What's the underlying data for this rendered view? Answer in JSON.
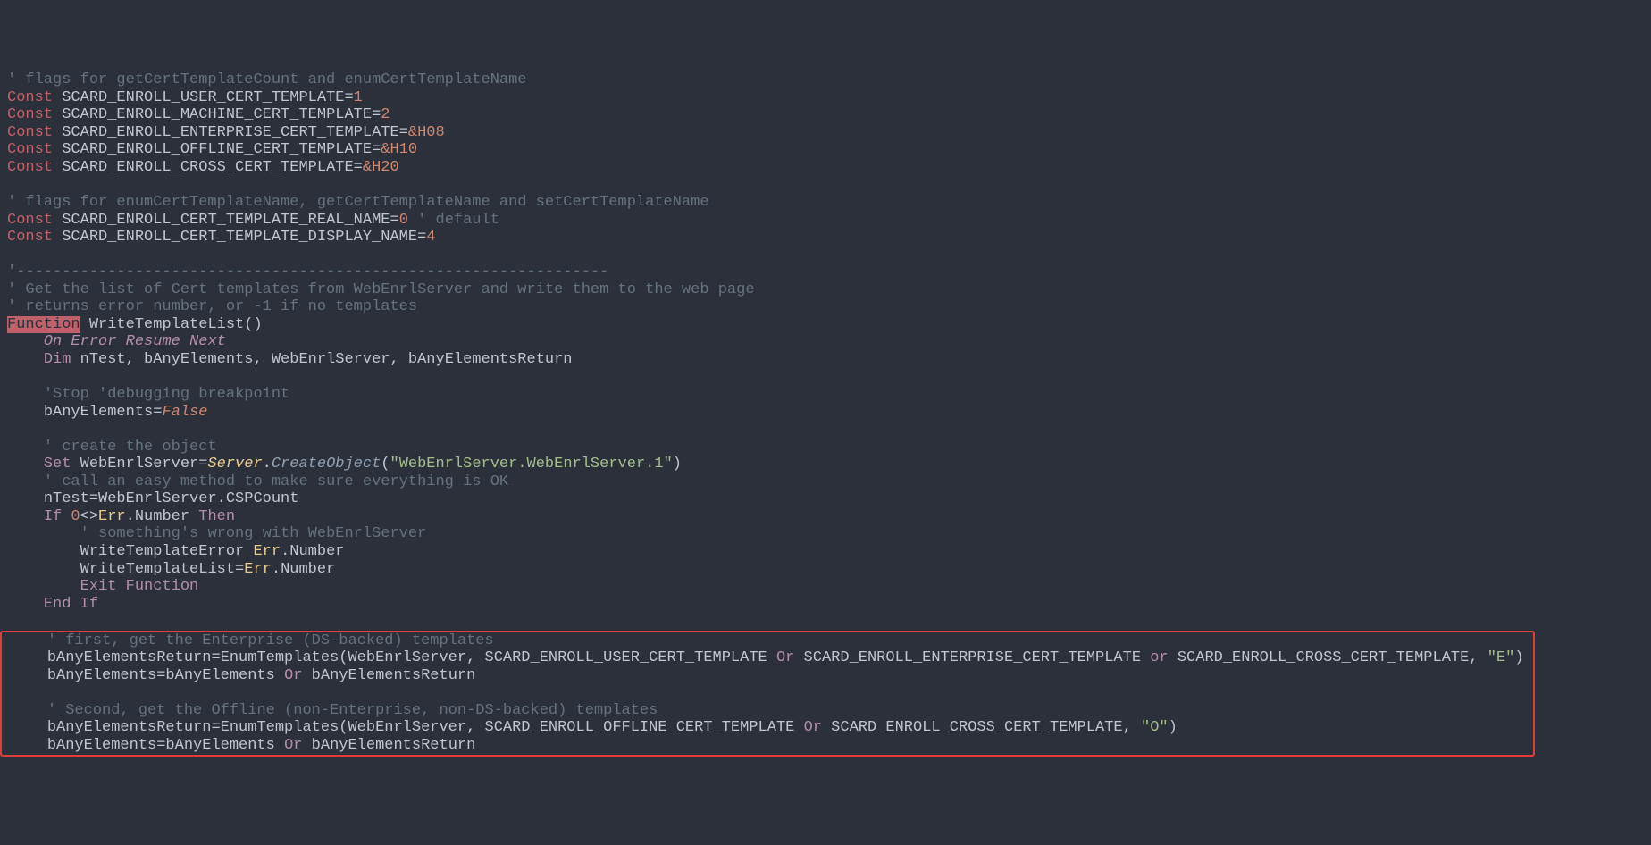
{
  "lines": {
    "l1": {
      "comment": "' flags for getCertTemplateCount and enumCertTemplateName"
    },
    "l2": {
      "kw": "Const",
      "rest": " SCARD_ENROLL_USER_CERT_TEMPLATE=",
      "num": "1"
    },
    "l3": {
      "kw": "Const",
      "rest": " SCARD_ENROLL_MACHINE_CERT_TEMPLATE=",
      "num": "2"
    },
    "l4": {
      "kw": "Const",
      "rest": " SCARD_ENROLL_ENTERPRISE_CERT_TEMPLATE=",
      "num": "&H08"
    },
    "l5": {
      "kw": "Const",
      "rest": " SCARD_ENROLL_OFFLINE_CERT_TEMPLATE=",
      "num": "&H10"
    },
    "l6": {
      "kw": "Const",
      "rest": " SCARD_ENROLL_CROSS_CERT_TEMPLATE=",
      "num": "&H20"
    },
    "l8": {
      "comment": "' flags for enumCertTemplateName, getCertTemplateName and setCertTemplateName"
    },
    "l9": {
      "kw": "Const",
      "rest": " SCARD_ENROLL_CERT_TEMPLATE_REAL_NAME=",
      "num": "0",
      "trail": " ' default"
    },
    "l10": {
      "kw": "Const",
      "rest": " SCARD_ENROLL_CERT_TEMPLATE_DISPLAY_NAME=",
      "num": "4"
    },
    "l12": {
      "comment": "'-----------------------------------------------------------------"
    },
    "l13": {
      "comment": "' Get the list of Cert templates from WebEnrlServer and write them to the web page"
    },
    "l14": {
      "comment": "' returns error number, or -1 if no templates"
    },
    "l15": {
      "func": "Function",
      "name": " WriteTemplateList()"
    },
    "l16": {
      "indent": "    ",
      "kw1": "On",
      "sp1": " ",
      "kw2": "Error",
      "sp2": " ",
      "kw3": "Resume",
      "sp3": " ",
      "kw4": "Next"
    },
    "l17": {
      "indent": "    ",
      "kw": "Dim",
      "rest": " nTest, bAnyElements, WebEnrlServer, bAnyElementsReturn"
    },
    "l19": {
      "indent": "    ",
      "comment": "'Stop 'debugging breakpoint"
    },
    "l20": {
      "indent": "    ",
      "lhs": "bAnyElements=",
      "val": "False"
    },
    "l22": {
      "indent": "    ",
      "comment": "' create the object"
    },
    "l23": {
      "indent": "    ",
      "kw": "Set",
      "rest1": " WebEnrlServer=",
      "srv": "Server",
      "dot": ".",
      "method": "CreateObject",
      "paren": "(",
      "str": "\"WebEnrlServer.WebEnrlServer.1\"",
      "close": ")"
    },
    "l24": {
      "indent": "    ",
      "comment": "' call an easy method to make sure everything is OK"
    },
    "l25": {
      "indent": "    ",
      "text": "nTest=WebEnrlServer.CSPCount"
    },
    "l26": {
      "indent": "    ",
      "kw1": "If",
      "sp1": " ",
      "num": "0",
      "op": "<>",
      "err": "Err",
      "rest": ".Number ",
      "kw2": "Then"
    },
    "l27": {
      "indent": "        ",
      "comment": "' something's wrong with WebEnrlServer"
    },
    "l28": {
      "indent": "        ",
      "text": "WriteTemplateError ",
      "err": "Err",
      "rest": ".Number"
    },
    "l29": {
      "indent": "        ",
      "text": "WriteTemplateList=",
      "err": "Err",
      "rest": ".Number"
    },
    "l30": {
      "indent": "        ",
      "kw1": "Exit",
      "sp": " ",
      "kw2": "Function"
    },
    "l31": {
      "indent": "    ",
      "kw1": "End",
      "sp": " ",
      "kw2": "If"
    },
    "l33": {
      "indent": "    ",
      "comment": "' first, get the Enterprise (DS-backed) templates"
    },
    "l34": {
      "indent": "    ",
      "pre": "bAnyElementsReturn=EnumTemplates(WebEnrlServer, SCARD_ENROLL_USER_CERT_TEMPLATE ",
      "or1": "Or",
      "mid1": " SCARD_ENROLL_ENTERPRISE_CERT_TEMPLATE ",
      "or2": "or",
      "mid2": " SCARD_ENROLL_CROSS_CERT_TEMPLATE, ",
      "str": "\"E\"",
      "close": ")"
    },
    "l35": {
      "indent": "    ",
      "pre": "bAnyElements=bAnyElements ",
      "or1": "Or",
      "post": " bAnyElementsReturn"
    },
    "l37": {
      "indent": "    ",
      "comment": "' Second, get the Offline (non-Enterprise, non-DS-backed) templates"
    },
    "l38": {
      "indent": "    ",
      "pre": "bAnyElementsReturn=EnumTemplates(WebEnrlServer, SCARD_ENROLL_OFFLINE_CERT_TEMPLATE ",
      "or1": "Or",
      "mid1": " SCARD_ENROLL_CROSS_CERT_TEMPLATE, ",
      "str": "\"O\"",
      "close": ")"
    },
    "l39": {
      "indent": "    ",
      "pre": "bAnyElements=bAnyElements ",
      "or1": "Or",
      "post": " bAnyElementsReturn"
    }
  }
}
